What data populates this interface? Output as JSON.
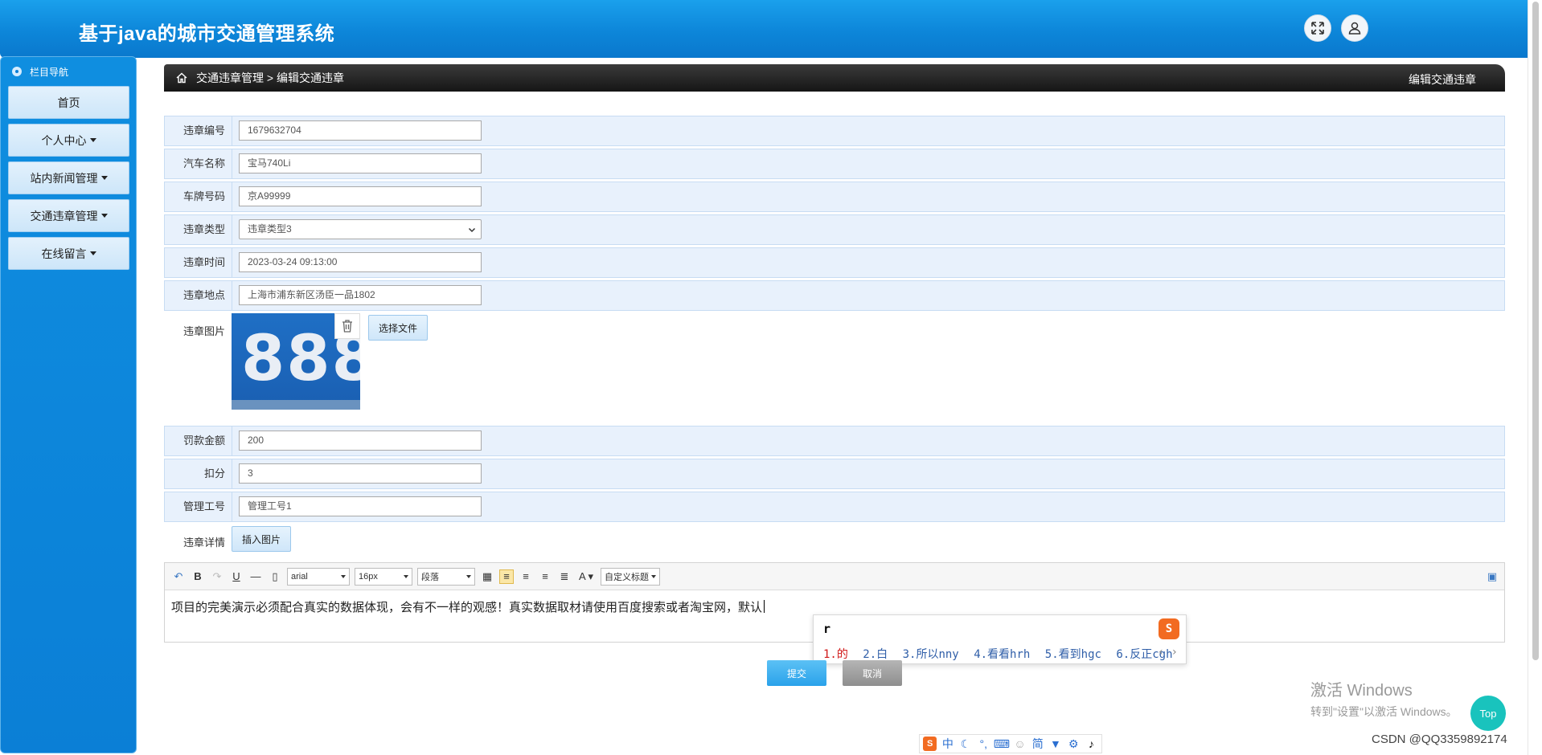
{
  "header": {
    "title": "基于java的城市交通管理系统"
  },
  "sidebar": {
    "heading": "栏目导航",
    "items": [
      {
        "label": "首页"
      },
      {
        "label": "个人中心"
      },
      {
        "label": "站内新闻管理"
      },
      {
        "label": "交通违章管理"
      },
      {
        "label": "在线留言"
      }
    ]
  },
  "breadcrumb": {
    "path": "交通违章管理 > 编辑交通违章",
    "page_title": "编辑交通违章"
  },
  "form": {
    "fields": [
      {
        "label": "违章编号",
        "value": "1679632704"
      },
      {
        "label": "汽车名称",
        "value": "宝马740Li"
      },
      {
        "label": "车牌号码",
        "value": "京A99999"
      },
      {
        "label": "违章类型",
        "value": "违章类型3"
      },
      {
        "label": "违章时间",
        "value": "2023-03-24 09:13:00"
      },
      {
        "label": "违章地点",
        "value": "上海市浦东新区汤臣一品1802"
      }
    ],
    "image_label": "违章图片",
    "image_text": "888",
    "choose_file": "选择文件",
    "fields2": [
      {
        "label": "罚款金额",
        "value": "200"
      },
      {
        "label": "扣分",
        "value": "3"
      },
      {
        "label": "管理工号",
        "value": "管理工号1"
      }
    ],
    "detail_label": "违章详情",
    "insert_image": "插入图片"
  },
  "editor": {
    "font": "arial",
    "size": "16px",
    "paragraph": "段落",
    "custom_title": "自定义标题",
    "content": "项目的完美演示必须配合真实的数据体现，会有不一样的观感！真实数据取材请使用百度搜索或者淘宝网，默认"
  },
  "ime": {
    "typed": "r",
    "candidates": [
      "1.的",
      "2.白",
      "3.所以nny",
      "4.看看hrh",
      "5.看到hgc",
      "6.反正cgh"
    ]
  },
  "buttons": {
    "submit": "提交",
    "cancel": "取消",
    "top": "Top"
  },
  "watermark": {
    "line1": "激活 Windows",
    "line2": "转到\"设置\"以激活 Windows。"
  },
  "footer": {
    "csdn": "CSDN @QQ3359892174"
  },
  "imebar": {
    "items": [
      "中",
      "简"
    ]
  }
}
